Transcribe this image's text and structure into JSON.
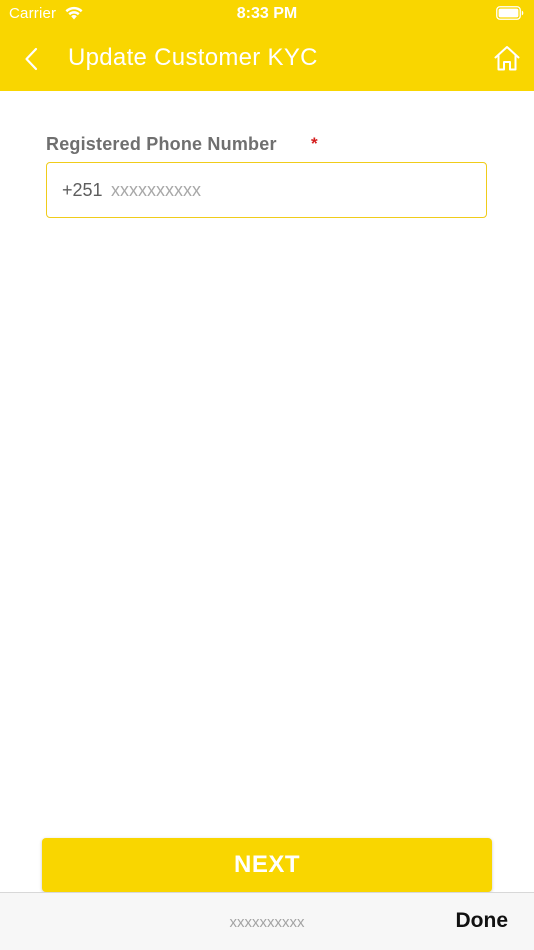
{
  "status_bar": {
    "carrier": "Carrier",
    "time": "8:33 PM"
  },
  "nav": {
    "title": "Update Customer KYC",
    "back_icon": "chevron-left-icon",
    "home_icon": "home-icon"
  },
  "form": {
    "phone_label": "Registered Phone Number",
    "required_mark": "*",
    "country_code": "+251",
    "phone_value": "",
    "phone_placeholder": "xxxxxxxxxx"
  },
  "actions": {
    "next_label": "NEXT"
  },
  "keyboard_toolbar": {
    "preview_text": "xxxxxxxxxx",
    "done_label": "Done"
  },
  "colors": {
    "brand": "#f9d600",
    "label": "#6f6f6f",
    "required": "#d41d1d",
    "input_border": "#f0cc1a"
  }
}
